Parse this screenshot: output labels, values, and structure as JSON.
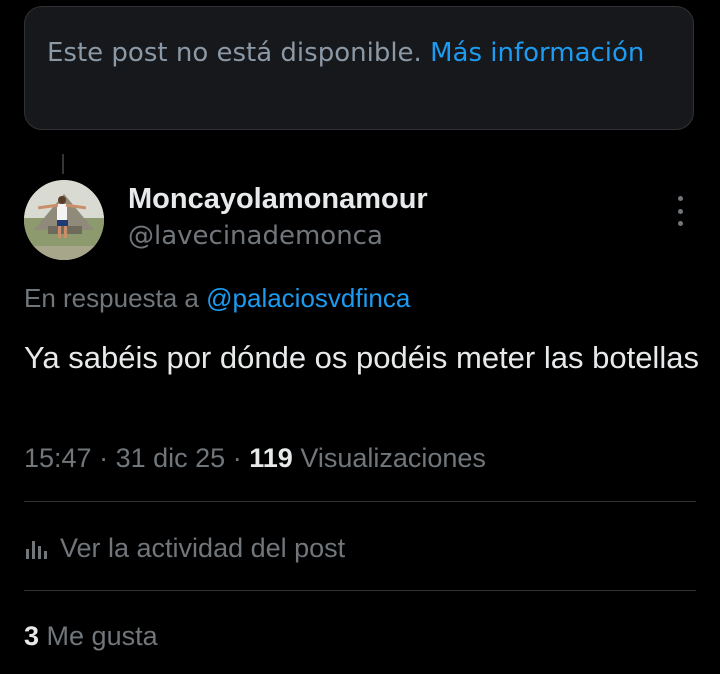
{
  "unavailable_notice": {
    "text": "Este post no está disponible.",
    "link_label": "Más información"
  },
  "post": {
    "author": {
      "display_name": "Moncayolamonamour",
      "handle": "@lavecinademonca"
    },
    "reply_prefix": "En respuesta a",
    "reply_to": "@palaciosvdfinca",
    "text": "Ya sabéis por dónde os podéis meter las botellas",
    "time": "15:47",
    "separator": "·",
    "date": "31 dic 25",
    "views_count": "119",
    "views_label": "Visualizaciones",
    "activity_label": "Ver la actividad del post",
    "likes_count": "3",
    "likes_label": "Me gusta"
  },
  "colors": {
    "background": "#000000",
    "text_primary": "#e7e9ea",
    "text_secondary": "#71767b",
    "link": "#1d9bf0",
    "card_bg": "#16181c",
    "border": "#2f3336"
  },
  "icons": {
    "more": "more-vertical-icon",
    "analytics": "analytics-icon"
  }
}
